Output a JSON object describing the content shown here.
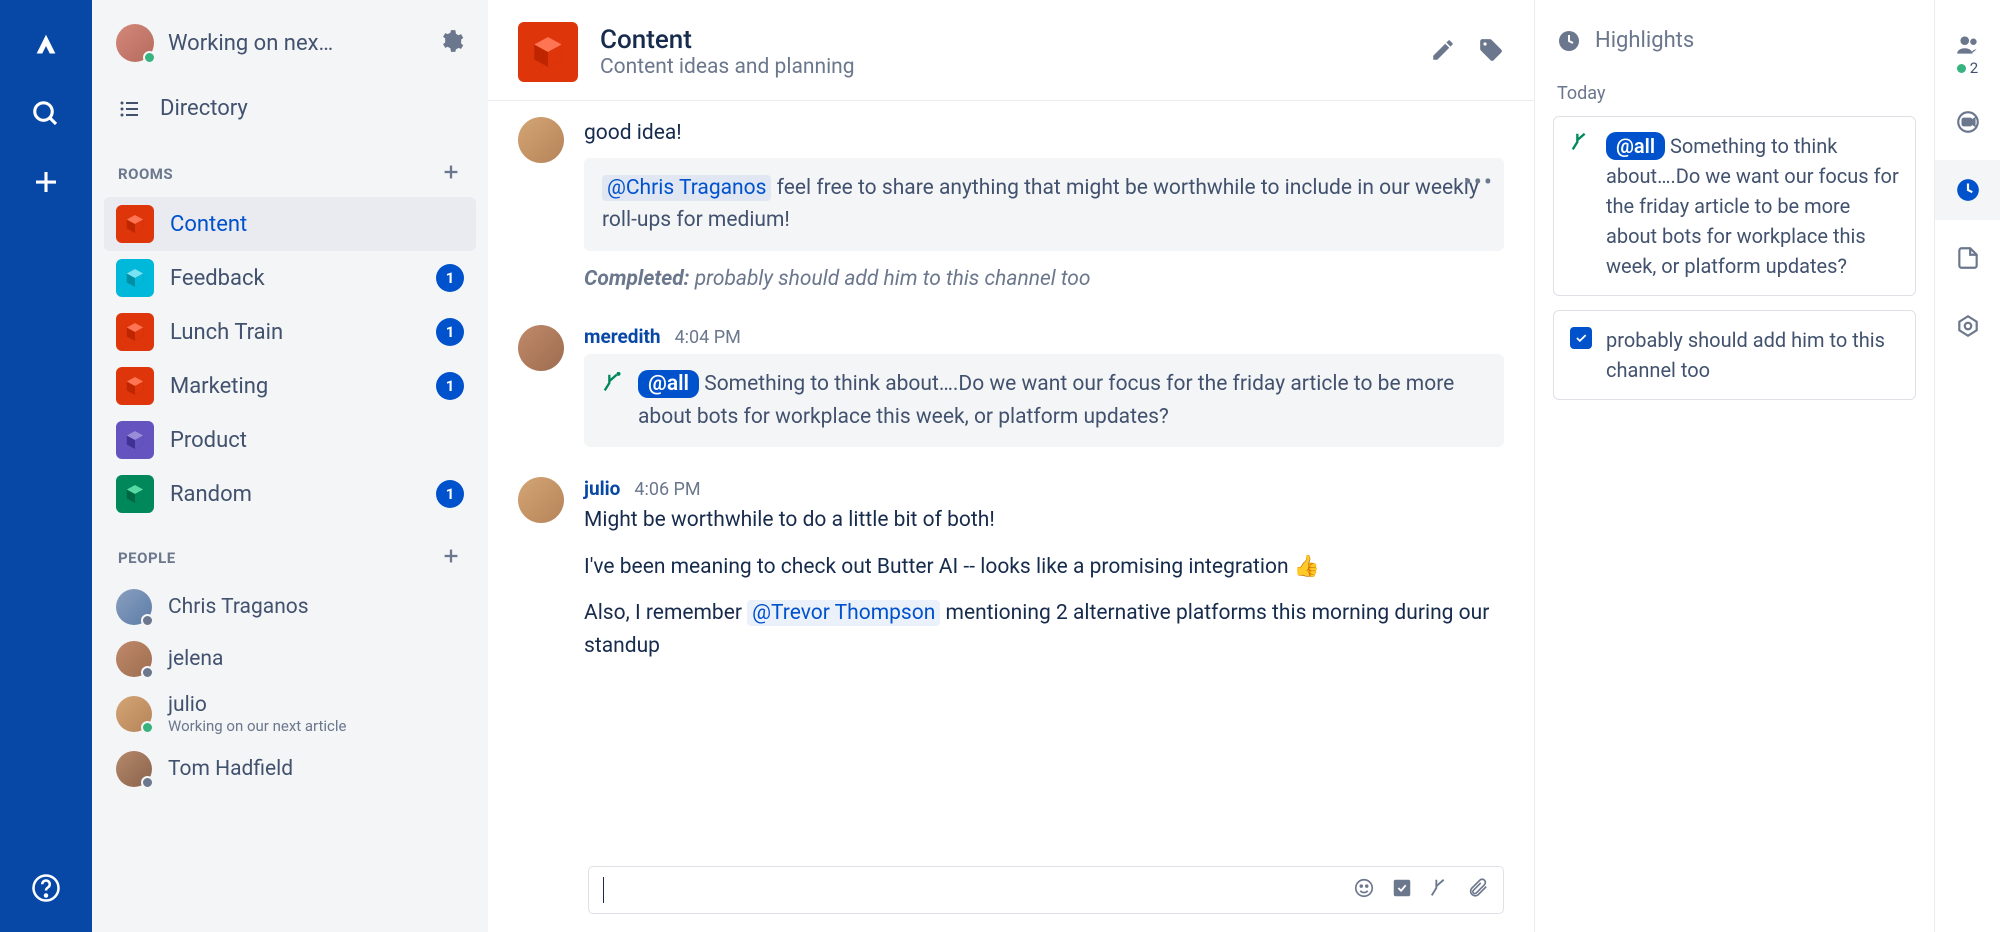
{
  "sidebar": {
    "status_title": "Working on nex…",
    "directory_label": "Directory",
    "rooms_header": "ROOMS",
    "people_header": "PEOPLE",
    "rooms": [
      {
        "name": "Content",
        "color": "#DE350B",
        "active": true,
        "badge": null
      },
      {
        "name": "Feedback",
        "color": "#00B8D9",
        "active": false,
        "badge": "1"
      },
      {
        "name": "Lunch Train",
        "color": "#DE350B",
        "active": false,
        "badge": "1"
      },
      {
        "name": "Marketing",
        "color": "#DE350B",
        "active": false,
        "badge": "1"
      },
      {
        "name": "Product",
        "color": "#6554C0",
        "active": false,
        "badge": null
      },
      {
        "name": "Random",
        "color": "#00875A",
        "active": false,
        "badge": "1"
      }
    ],
    "people": [
      {
        "name": "Chris Traganos",
        "sub": null,
        "presence": "away"
      },
      {
        "name": "jelena",
        "sub": null,
        "presence": "away"
      },
      {
        "name": "julio",
        "sub": "Working on our next article",
        "presence": "online"
      },
      {
        "name": "Tom Hadfield",
        "sub": null,
        "presence": "away"
      }
    ]
  },
  "channel": {
    "title": "Content",
    "subtitle": "Content ideas and planning"
  },
  "messages": {
    "m1_text": "good idea!",
    "m1_callout_mention": "@Chris Traganos",
    "m1_callout_rest": " feel free to share anything that might be worthwhile to include in our weekly roll-ups for medium!",
    "m1_completed_label": "Completed:",
    "m1_completed_text": " probably should add him to this channel too",
    "m2_user": "meredith",
    "m2_time": "4:04 PM",
    "m2_all": "@all",
    "m2_text": " Something to think about….Do we want our focus for the friday article to be more about bots for workplace this week, or platform updates?",
    "m3_user": "julio",
    "m3_time": "4:06 PM",
    "m3_p1": "Might be worthwhile to do a little bit of both!",
    "m3_p2a": "I've been meaning to check out Butter AI -- looks like a promising integration ",
    "m3_emoji": "👍",
    "m3_p3a": "Also, I remember ",
    "m3_mention": "@Trevor Thompson",
    "m3_p3b": " mentioning 2 alternative platforms this morning during our standup"
  },
  "highlights": {
    "title": "Highlights",
    "date": "Today",
    "card1_all": "@all",
    "card1_text": " Something to think about….Do we want our focus for the friday article to be more about bots for workplace this week, or platform updates?",
    "card2_text": "probably should add him to this channel too"
  },
  "rail_right": {
    "people_count": "2"
  }
}
